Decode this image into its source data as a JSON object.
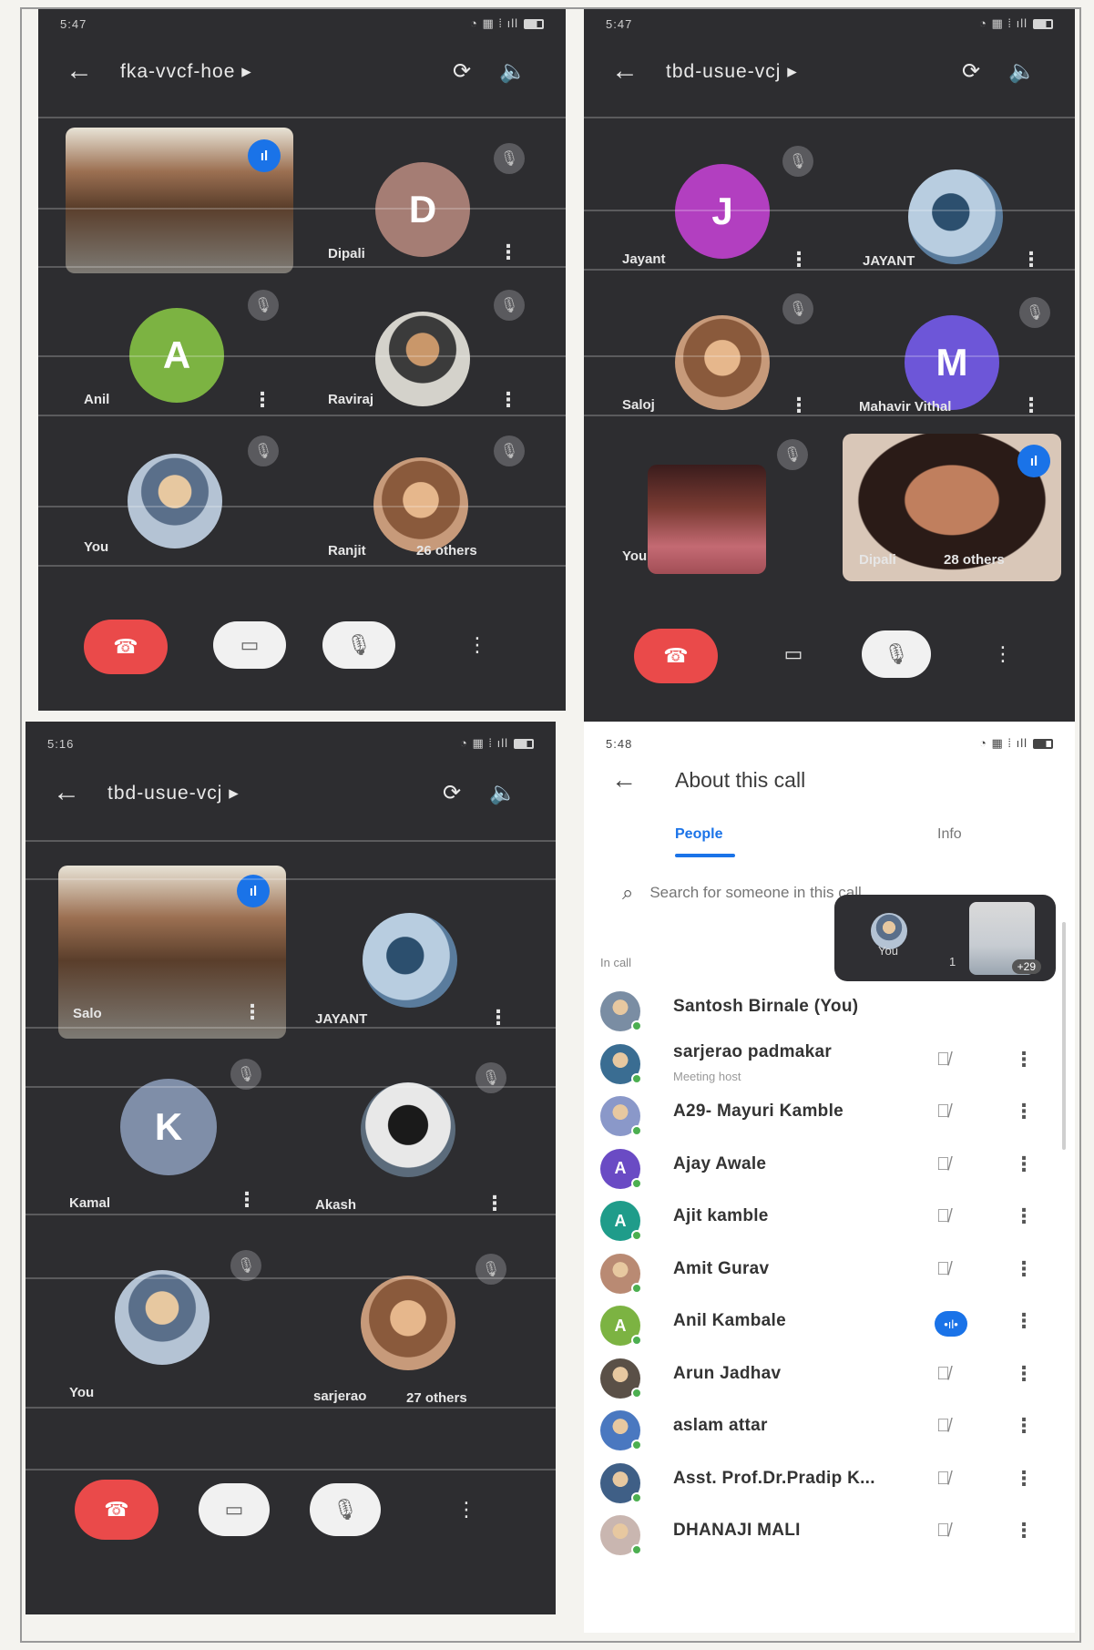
{
  "panels": {
    "tl": {
      "status_time": "5:47",
      "meeting_code": "fka-vvcf-hoe",
      "tiles": [
        {
          "name": "",
          "kind": "video"
        },
        {
          "name": "Dipali",
          "kind": "letter",
          "letter": "D"
        },
        {
          "name": "Anil",
          "kind": "letter",
          "letter": "A"
        },
        {
          "name": "Raviraj",
          "kind": "photo"
        },
        {
          "name": "You",
          "kind": "photo"
        },
        {
          "name": "Ranjit",
          "kind": "photo",
          "others": "26 others"
        }
      ]
    },
    "tr": {
      "status_time": "5:47",
      "meeting_code": "tbd-usue-vcj",
      "tiles": [
        {
          "name": "Jayant",
          "kind": "letter",
          "letter": "J"
        },
        {
          "name": "JAYANT",
          "kind": "photo"
        },
        {
          "name": "Saloj",
          "kind": "photo"
        },
        {
          "name": "Mahavir Vithal",
          "kind": "letter",
          "letter": "M"
        },
        {
          "name": "You",
          "kind": "video"
        },
        {
          "name": "Dipali",
          "kind": "video",
          "others": "28 others"
        }
      ]
    },
    "bl": {
      "status_time": "5:16",
      "meeting_code": "tbd-usue-vcj",
      "tiles": [
        {
          "name": "Salo",
          "kind": "video"
        },
        {
          "name": "JAYANT",
          "kind": "photo"
        },
        {
          "name": "Kamal",
          "kind": "letter",
          "letter": "K"
        },
        {
          "name": "Akash",
          "kind": "photo"
        },
        {
          "name": "You",
          "kind": "photo"
        },
        {
          "name": "sarjerao",
          "kind": "photo",
          "others": "27 others"
        }
      ]
    }
  },
  "about": {
    "status_time": "5:48",
    "title": "About this call",
    "tabs": [
      "People",
      "Info"
    ],
    "search_placeholder": "Search for someone in this call",
    "section_label": "In call",
    "pip": {
      "self_label": "You",
      "count_badge": "+29",
      "count_prefix": "1"
    },
    "people": [
      {
        "name": "Santosh Birnale (You)",
        "sub": "",
        "mic": "none",
        "avatar": "photo",
        "color": "#7a8da3"
      },
      {
        "name": "sarjerao padmakar",
        "sub": "Meeting host",
        "mic": "muted",
        "avatar": "photo",
        "color": "#3a6d92"
      },
      {
        "name": "A29- Mayuri Kamble",
        "sub": "",
        "mic": "muted",
        "avatar": "photo",
        "color": "#8a98c9"
      },
      {
        "name": "Ajay Awale",
        "sub": "",
        "mic": "muted",
        "avatar": "A",
        "color": "#6a4bc4"
      },
      {
        "name": "Ajit kamble",
        "sub": "",
        "mic": "muted",
        "avatar": "A",
        "color": "#1f9c8a"
      },
      {
        "name": "Amit Gurav",
        "sub": "",
        "mic": "muted",
        "avatar": "photo",
        "color": "#b98a73"
      },
      {
        "name": "Anil Kambale",
        "sub": "",
        "mic": "speaking",
        "avatar": "A",
        "color": "#7cb342"
      },
      {
        "name": "Arun Jadhav",
        "sub": "",
        "mic": "muted",
        "avatar": "photo",
        "color": "#5a5047"
      },
      {
        "name": "aslam attar",
        "sub": "",
        "mic": "muted",
        "avatar": "photo",
        "color": "#4a78c0"
      },
      {
        "name": "Asst. Prof.Dr.Pradip K...",
        "sub": "",
        "mic": "muted",
        "avatar": "photo",
        "color": "#3f5f86"
      },
      {
        "name": "DHANAJI MALI",
        "sub": "",
        "mic": "muted",
        "avatar": "photo",
        "color": "#c9b6b0"
      }
    ]
  },
  "icons": {
    "back": "arrow-left-icon",
    "switch_camera": "switch-camera-icon",
    "speaker": "speaker-icon",
    "end_call": "end-call-icon",
    "camera_off": "camera-off-icon",
    "mic_off": "mic-off-icon",
    "more": "more-vertical-icon",
    "search": "search-icon"
  },
  "colors": {
    "call_bg": "#2d2d30",
    "end_call": "#ea4a4a",
    "accent": "#1a73e8"
  }
}
